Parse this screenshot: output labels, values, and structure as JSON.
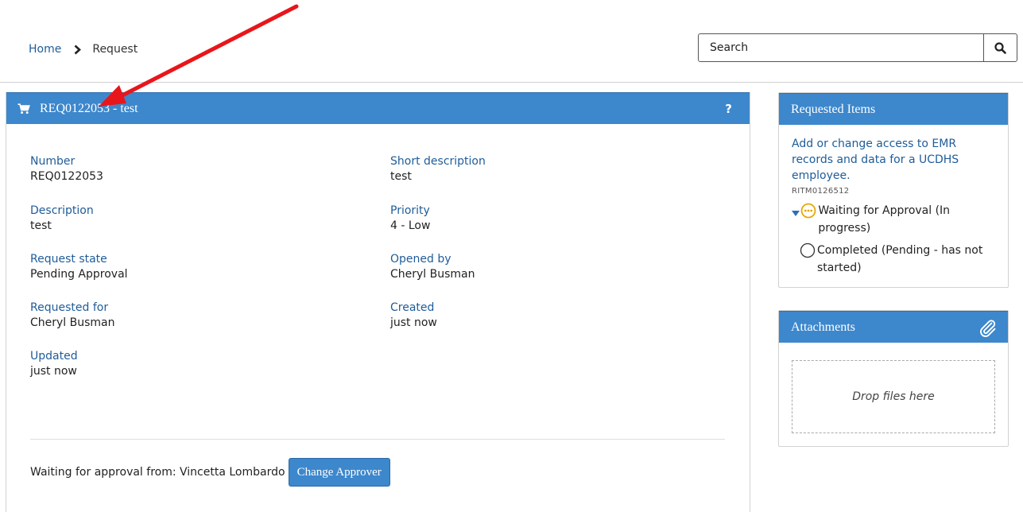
{
  "breadcrumb": {
    "home": "Home",
    "current": "Request"
  },
  "search": {
    "placeholder": "Search"
  },
  "request": {
    "header_title": "REQ0122053 - test",
    "help": "?",
    "fields": {
      "number": {
        "label": "Number",
        "value": "REQ0122053"
      },
      "short_description": {
        "label": "Short description",
        "value": "test"
      },
      "description": {
        "label": "Description",
        "value": "test"
      },
      "priority": {
        "label": "Priority",
        "value": "4 - Low"
      },
      "request_state": {
        "label": "Request state",
        "value": "Pending Approval"
      },
      "opened_by": {
        "label": "Opened by",
        "value": "Cheryl Busman"
      },
      "requested_for": {
        "label": "Requested for",
        "value": "Cheryl Busman"
      },
      "created": {
        "label": "Created",
        "value": "just now"
      },
      "updated": {
        "label": "Updated",
        "value": "just now"
      }
    },
    "approval_text": "Waiting for approval from: Vincetta Lombardo",
    "change_approver_label": "Change Approver"
  },
  "requested_items": {
    "title": "Requested Items",
    "item_link": "Add or change access to EMR records and data for a UCDHS employee.",
    "item_number": "RITM0126512",
    "stages": [
      {
        "label": "Waiting for Approval (In progress)",
        "icon": "in-progress-icon"
      },
      {
        "label": "Completed (Pending - has not started)",
        "icon": "pending-circle-icon"
      }
    ]
  },
  "attachments": {
    "title": "Attachments",
    "drop_text": "Drop files here"
  },
  "colors": {
    "header_blue": "#3d87cc",
    "link_blue": "#1f5c99",
    "annotation_red": "#e8161b",
    "in_progress_yellow": "#e6a800"
  }
}
